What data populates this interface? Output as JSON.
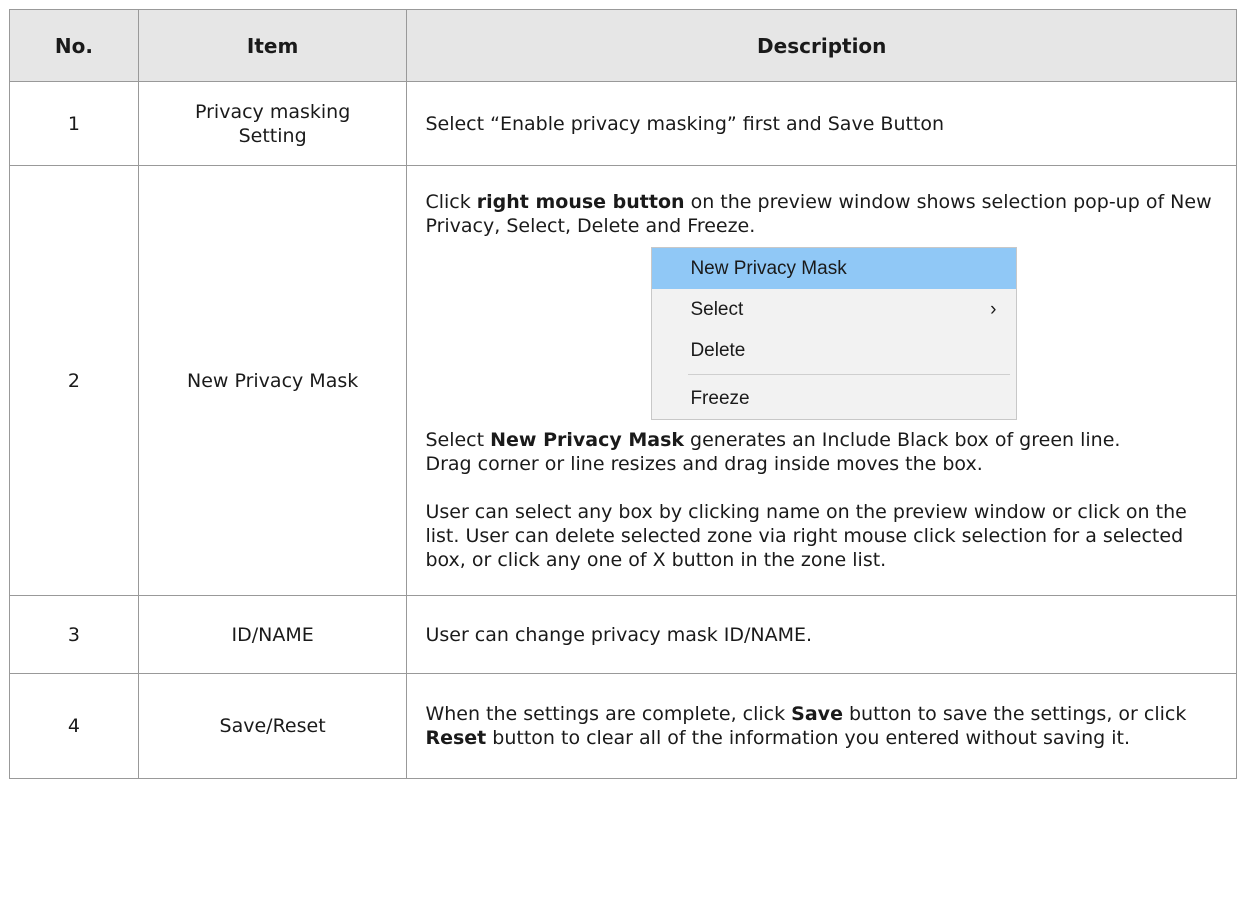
{
  "headers": {
    "no": "No.",
    "item": "Item",
    "description": "Description"
  },
  "rows": [
    {
      "no": "1",
      "item": "Privacy masking Setting",
      "desc": "Select “Enable privacy masking” first and Save Button"
    },
    {
      "no": "2",
      "item": "New Privacy Mask",
      "p1_a": "Click ",
      "p1_b": "right mouse button",
      "p1_c": " on the preview window shows selection pop-up of New Privacy, Select, Delete and Freeze.",
      "menu": {
        "items": [
          "New Privacy Mask",
          "Select",
          "Delete",
          "Freeze"
        ],
        "submenu_glyph": "›"
      },
      "p2_a": "Select ",
      "p2_b": "New Privacy Mask",
      "p2_c": " generates an Include Black box of green line.",
      "p3": "Drag corner or line resizes and drag inside moves the box.",
      "p4": "User can select any box by clicking name on the preview window or click on the list. User can delete selected zone via right mouse click selection for a selected box, or click any one of X button in the zone list."
    },
    {
      "no": "3",
      "item": "ID/NAME",
      "desc": "User can change privacy mask ID/NAME."
    },
    {
      "no": "4",
      "item": "Save/Reset",
      "d_a": "When the settings are complete, click ",
      "d_b": "Save",
      "d_c": " button to save the settings, or click ",
      "d_d": "Reset",
      "d_e": " button to clear all of the information you entered without saving it."
    }
  ],
  "colors": {
    "header_bg": "#e6e6e6",
    "menu_bg": "#f2f2f2",
    "menu_highlight": "#90c8f6",
    "border": "#999999"
  }
}
